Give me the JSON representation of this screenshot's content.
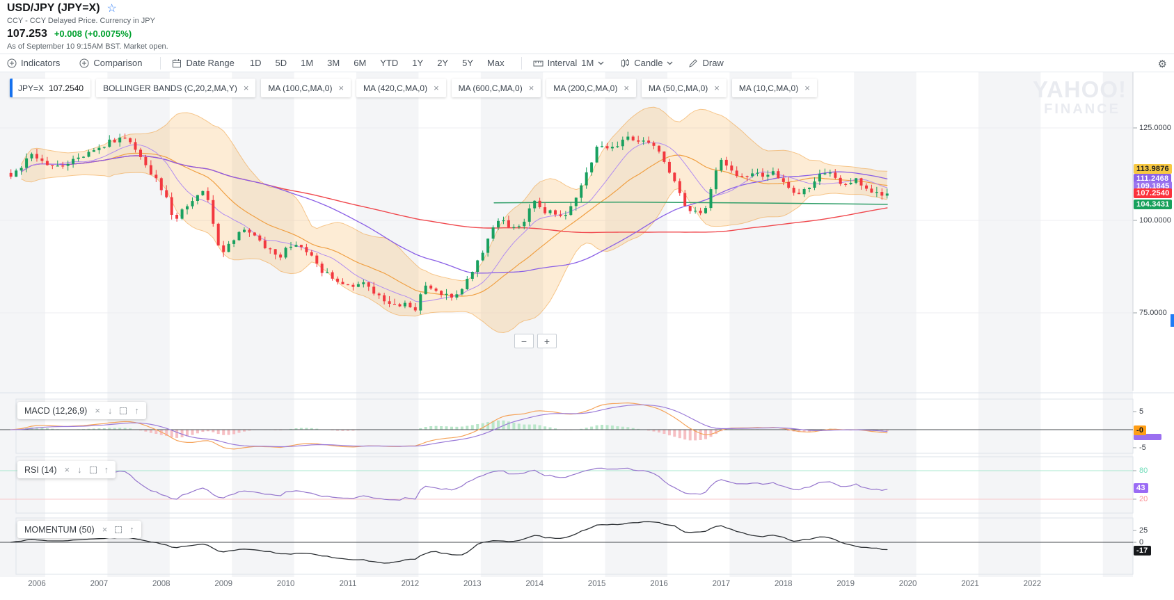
{
  "header": {
    "title": "USD/JPY (JPY=X)",
    "subtitle": "CCY - CCY Delayed Price. Currency in JPY",
    "price": "107.253",
    "change": "+0.008 (+0.0075%)",
    "as_of": "As of September 10 9:15AM BST. Market open."
  },
  "icons": {
    "close": "×",
    "down": "↓",
    "up": "↑",
    "gear": "⚙",
    "star": "☆",
    "plus_circle": "plus-circle",
    "calendar": "calendar",
    "ruler": "ruler",
    "candle": "candlestick",
    "pencil": "pencil"
  },
  "toolbar": {
    "indicators_label": "Indicators",
    "comparison_label": "Comparison",
    "date_range_label": "Date Range",
    "ranges": [
      "1D",
      "5D",
      "1M",
      "3M",
      "6M",
      "YTD",
      "1Y",
      "2Y",
      "5Y",
      "Max"
    ],
    "interval_label": "Interval",
    "interval_value": "1M",
    "chart_type_label": "Candle",
    "draw_label": "Draw"
  },
  "pills": {
    "main": {
      "symbol": "JPY=X",
      "value": "107.2540"
    },
    "indicators": [
      {
        "label": "BOLLINGER BANDS (C,20,2,MA,Y)"
      },
      {
        "label": "MA (100,C,MA,0)"
      },
      {
        "label": "MA (420,C,MA,0)"
      },
      {
        "label": "MA (600,C,MA,0)"
      },
      {
        "label": "MA (200,C,MA,0)"
      },
      {
        "label": "MA (50,C,MA,0)"
      },
      {
        "label": "MA (10,C,MA,0)"
      }
    ]
  },
  "watermark": {
    "line1": "YAHOO!",
    "line2": "FINANCE"
  },
  "price_axis": {
    "ticks": [
      {
        "price": 125,
        "label": "125.0000"
      },
      {
        "price": 100,
        "label": "100.0000"
      },
      {
        "price": 75,
        "label": "75.0000"
      }
    ],
    "badges": [
      {
        "label": "113.9876",
        "price": 113.9876,
        "bg": "#f7c842",
        "fg": "#1d1d1f"
      },
      {
        "label": "111.2468",
        "price": 111.2468,
        "bg": "#8b62e9",
        "fg": "#ffffff"
      },
      {
        "label": "109.1845",
        "price": 109.1845,
        "bg": "#9a74ee",
        "fg": "#ffffff"
      },
      {
        "label": "107.2540",
        "price": 107.254,
        "bg": "#fb323c",
        "fg": "#ffffff"
      },
      {
        "label": "104.3431",
        "price": 104.3431,
        "bg": "#18a15c",
        "fg": "#ffffff"
      }
    ]
  },
  "panels": {
    "macd": {
      "label": "MACD (12,26,9)",
      "ticks": [
        {
          "v": 5,
          "label": "5"
        },
        {
          "v": -5,
          "label": "-5"
        }
      ],
      "badge": {
        "label": "-0",
        "v": -0.2,
        "bg": "#ff9e16",
        "fg": "#15171a"
      }
    },
    "rsi": {
      "label": "RSI (14)",
      "ticks": [
        {
          "v": 80,
          "label": "80",
          "color": "#6edcb8"
        },
        {
          "v": 20,
          "label": "20",
          "color": "#fb8e92"
        }
      ],
      "badge": {
        "label": "43",
        "v": 43,
        "bg": "#9a6bf5",
        "fg": "#ffffff"
      }
    },
    "momentum": {
      "label": "MOMENTUM (50)",
      "ticks": [
        {
          "v": 25,
          "label": "25"
        },
        {
          "v": 0,
          "label": "0"
        }
      ],
      "badge": {
        "label": "-17",
        "v": -17.5,
        "bg": "#17191c",
        "fg": "#ffffff"
      }
    }
  },
  "x_axis": {
    "years": [
      2006,
      2007,
      2008,
      2009,
      2010,
      2011,
      2012,
      2013,
      2014,
      2015,
      2016,
      2017,
      2018,
      2019,
      2020,
      2021,
      2022
    ]
  },
  "zoom_controls": {
    "minus": "−",
    "plus": "+"
  },
  "colors": {
    "accent_blue": "#188fff",
    "up_green": "#18a05f",
    "down_red": "#f2383f",
    "change_green": "#00a12f",
    "bollinger_fill": "rgba(245,167,66,0.22)",
    "bollinger_edge": "rgba(240,158,60,0.55)",
    "ma20_orange": "#f09f42",
    "ma10_violet": "#b18cf0",
    "ma50_purple": "#8a5fe6",
    "ma100_red": "#f0484d",
    "ma_long_green": "#2f9e68",
    "macd_line": "#f5a35a",
    "macd_signal": "#9b7bd8",
    "hist_up": "#b9e6c9",
    "hist_down": "#f6bfc3",
    "rsi_line": "#9575cd",
    "rsi_high": "#a9e8cf",
    "rsi_low": "#f9c9cb",
    "momentum_line": "#2b2f33",
    "stripe": "#f4f5f7",
    "watermark": "#e9ebf0"
  },
  "chart_data": {
    "type": "candlestick",
    "symbol": "JPY=X",
    "interval": "1M",
    "title": "USD/JPY monthly candlestick chart with Bollinger Bands, moving averages, MACD, RSI and Momentum",
    "x_domain_years": [
      2005.583,
      2019.667
    ],
    "y_axis": {
      "min_visible": 70,
      "max_visible": 132,
      "ticks": [
        125,
        100,
        75
      ]
    },
    "last_close": 107.254,
    "monthly_close_keypoints": [
      [
        2005.58,
        111.2
      ],
      [
        2005.92,
        118.0
      ],
      [
        2006.08,
        116.0
      ],
      [
        2006.42,
        114.4
      ],
      [
        2006.75,
        117.5
      ],
      [
        2007.08,
        120.5
      ],
      [
        2007.45,
        123.2
      ],
      [
        2007.75,
        115.2
      ],
      [
        2008.08,
        106.5
      ],
      [
        2008.21,
        99.9
      ],
      [
        2008.54,
        106.4
      ],
      [
        2008.71,
        108.7
      ],
      [
        2008.87,
        95.5
      ],
      [
        2009.0,
        90.7
      ],
      [
        2009.29,
        98.5
      ],
      [
        2009.54,
        95.0
      ],
      [
        2009.87,
        89.5
      ],
      [
        2010.08,
        93.3
      ],
      [
        2010.42,
        91.0
      ],
      [
        2010.58,
        86.4
      ],
      [
        2010.87,
        82.5
      ],
      [
        2011.08,
        81.7
      ],
      [
        2011.29,
        83.2
      ],
      [
        2011.62,
        77.0
      ],
      [
        2011.87,
        77.6
      ],
      [
        2012.08,
        76.2
      ],
      [
        2012.25,
        82.9
      ],
      [
        2012.54,
        79.3
      ],
      [
        2012.79,
        79.9
      ],
      [
        2013.0,
        86.1
      ],
      [
        2013.21,
        93.5
      ],
      [
        2013.42,
        100.4
      ],
      [
        2013.58,
        98.9
      ],
      [
        2013.79,
        98.3
      ],
      [
        2014.0,
        105.3
      ],
      [
        2014.17,
        102.1
      ],
      [
        2014.5,
        101.8
      ],
      [
        2014.75,
        109.2
      ],
      [
        2015.0,
        119.7
      ],
      [
        2015.29,
        119.9
      ],
      [
        2015.46,
        123.0
      ],
      [
        2015.67,
        121.3
      ],
      [
        2015.96,
        120.3
      ],
      [
        2016.17,
        112.6
      ],
      [
        2016.46,
        102.7
      ],
      [
        2016.71,
        101.2
      ],
      [
        2016.87,
        110.0
      ],
      [
        2016.96,
        116.9
      ],
      [
        2017.25,
        111.3
      ],
      [
        2017.54,
        112.3
      ],
      [
        2017.87,
        112.8
      ],
      [
        2018.08,
        108.8
      ],
      [
        2018.21,
        106.2
      ],
      [
        2018.54,
        111.6
      ],
      [
        2018.79,
        113.1
      ],
      [
        2018.96,
        109.6
      ],
      [
        2019.17,
        110.8
      ],
      [
        2019.42,
        108.0
      ],
      [
        2019.58,
        106.2
      ],
      [
        2019.667,
        107.254
      ]
    ],
    "overlays": {
      "bollinger": {
        "window": 20,
        "mult": 2
      },
      "ma_windows": {
        "ma10": 10,
        "ma50": 50,
        "ma100": 100
      },
      "ma_long_green_segment": [
        [
          2013.35,
          104.75
        ],
        [
          2015.5,
          104.95
        ],
        [
          2017.6,
          104.7
        ],
        [
          2019.67,
          104.34
        ]
      ]
    },
    "sub_indicators": {
      "macd": {
        "fast": 12,
        "slow": 26,
        "signal": 9
      },
      "rsi": {
        "period": 14
      },
      "momentum": {
        "period": 50
      }
    }
  }
}
